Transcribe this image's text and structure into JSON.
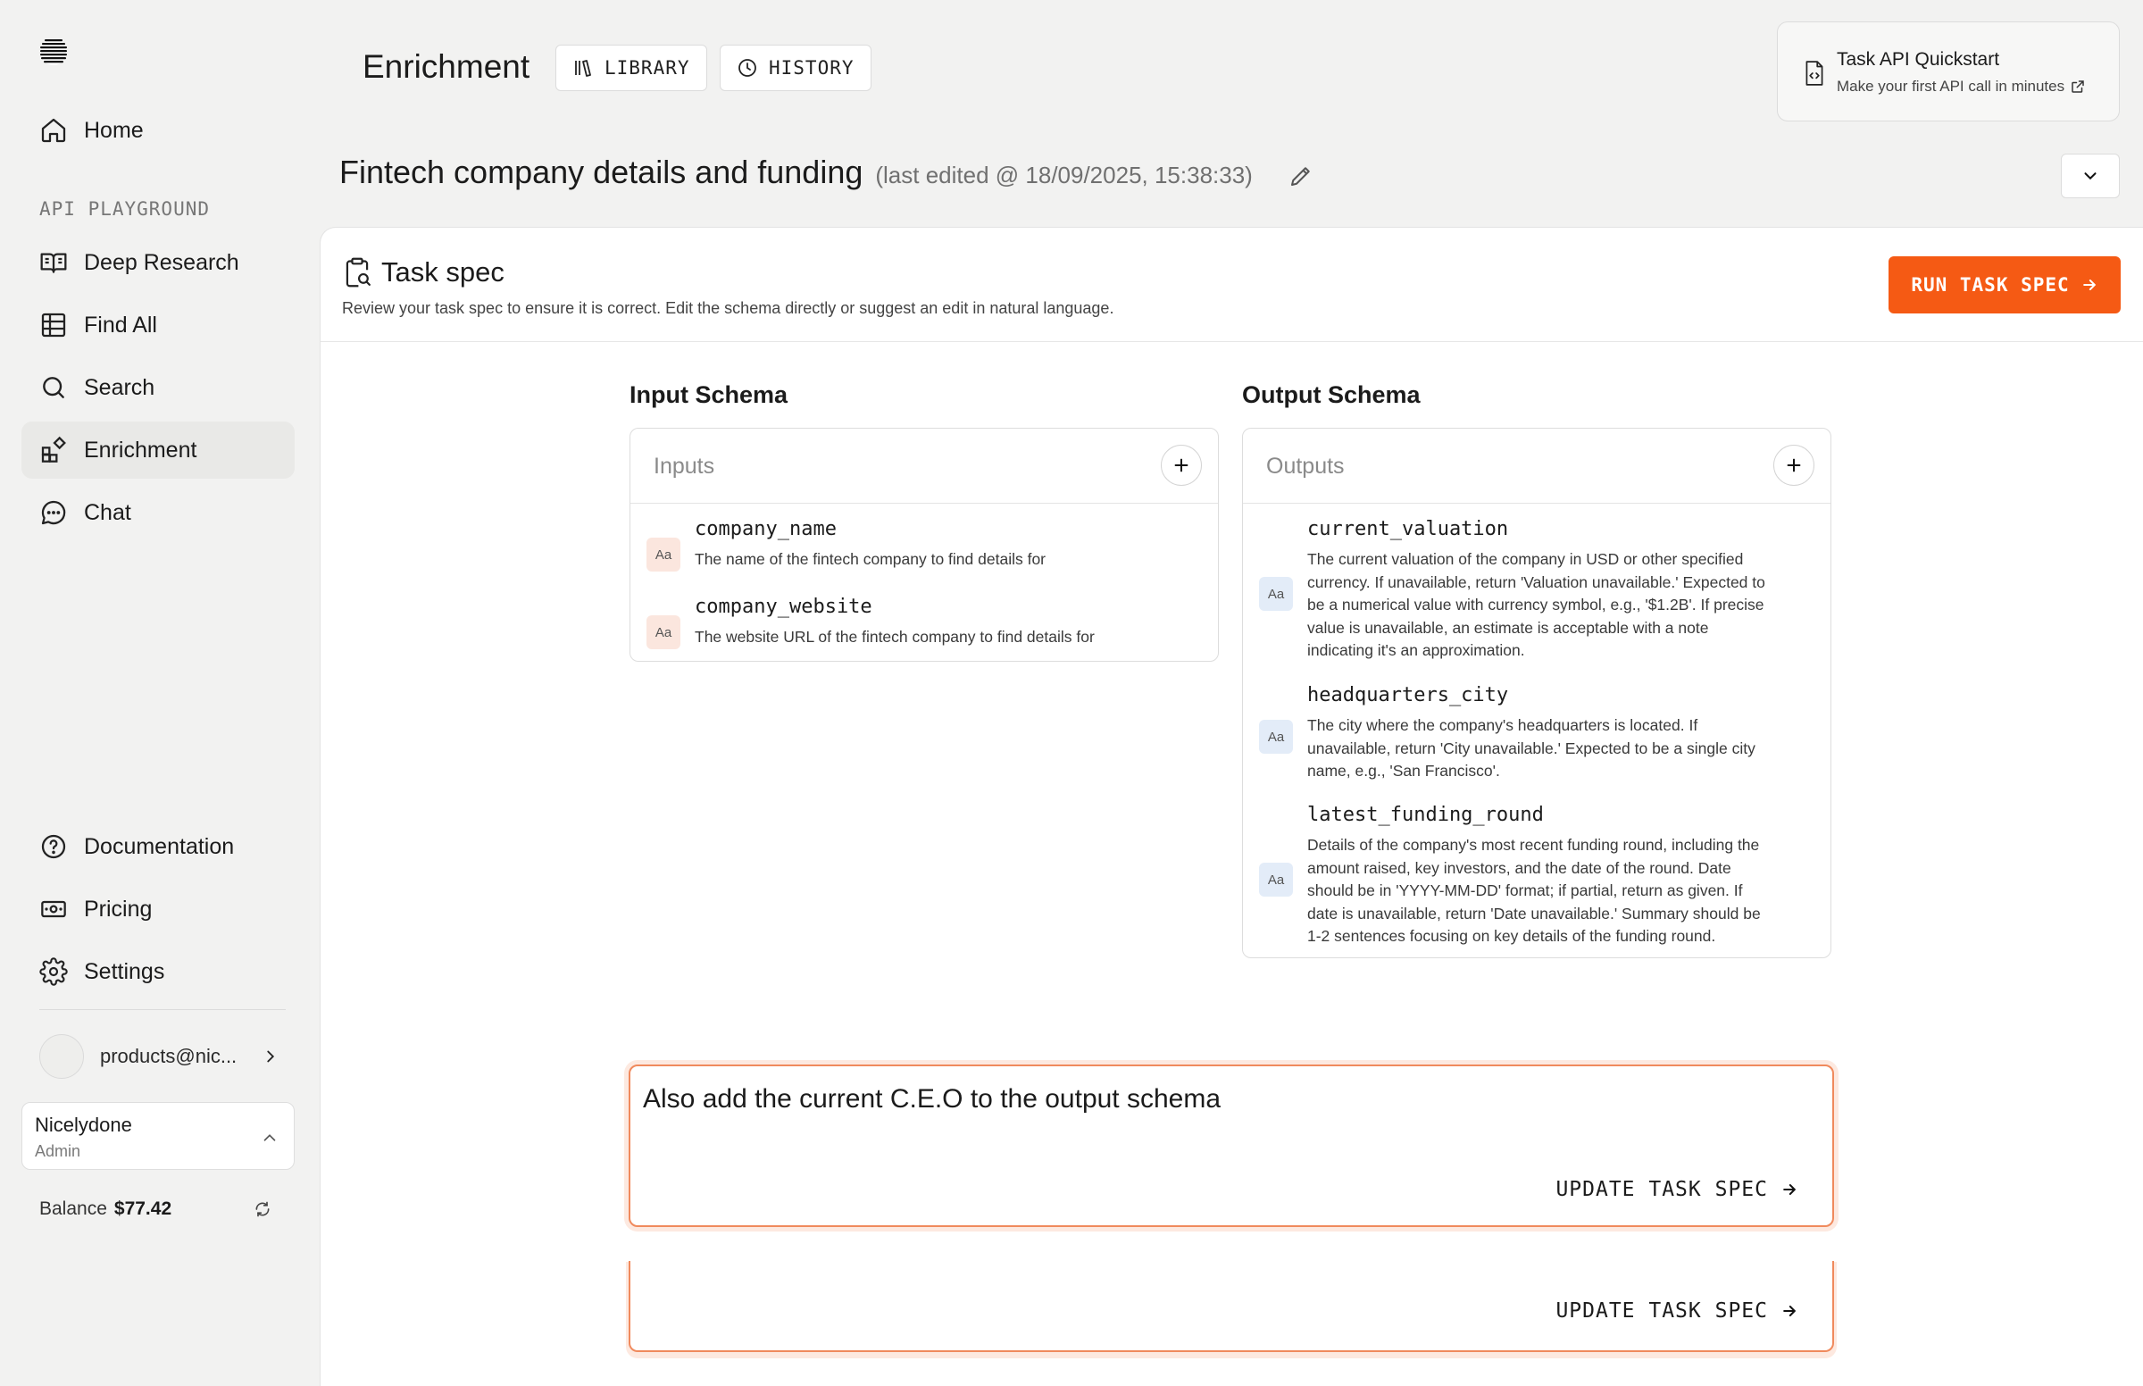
{
  "sidebar": {
    "nav_top": [
      {
        "label": "Home",
        "icon": "home-icon"
      }
    ],
    "section_label": "API PLAYGROUND",
    "nav_playground": [
      {
        "label": "Deep Research",
        "icon": "book-icon"
      },
      {
        "label": "Find All",
        "icon": "grid-icon"
      },
      {
        "label": "Search",
        "icon": "search-icon"
      },
      {
        "label": "Enrichment",
        "icon": "enrichment-icon",
        "active": true
      },
      {
        "label": "Chat",
        "icon": "chat-icon"
      }
    ],
    "nav_bottom": [
      {
        "label": "Documentation",
        "icon": "help-circle-icon"
      },
      {
        "label": "Pricing",
        "icon": "banknote-icon"
      },
      {
        "label": "Settings",
        "icon": "gear-icon"
      }
    ],
    "account_email": "products@nic...",
    "org_name": "Nicelydone",
    "org_role": "Admin",
    "balance_label": "Balance",
    "balance_value": "$77.42"
  },
  "header": {
    "title": "Enrichment",
    "library_label": "LIBRARY",
    "history_label": "HISTORY",
    "quickstart_title": "Task API Quickstart",
    "quickstart_subtitle": "Make your first API call in minutes"
  },
  "task": {
    "title": "Fintech company details and funding",
    "edited": "(last edited @ 18/09/2025, 15:38:33)"
  },
  "spec": {
    "title": "Task spec",
    "description": "Review your task spec to ensure it is correct. Edit the schema directly or suggest an edit in natural language.",
    "run_label": "RUN TASK SPEC"
  },
  "input_schema": {
    "title": "Input Schema",
    "card_label": "Inputs",
    "fields": [
      {
        "type_badge": "Aa",
        "name": "company_name",
        "description": "The name of the fintech company to find details for"
      },
      {
        "type_badge": "Aa",
        "name": "company_website",
        "description": "The website URL of the fintech company to find details for"
      }
    ]
  },
  "output_schema": {
    "title": "Output Schema",
    "card_label": "Outputs",
    "fields": [
      {
        "type_badge": "Aa",
        "name": "current_valuation",
        "description": "The current valuation of the company in USD or other specified currency. If unavailable, return 'Valuation unavailable.' Expected to be a numerical value with currency symbol, e.g., '$1.2B'. If precise value is unavailable, an estimate is acceptable with a note indicating it's an approximation."
      },
      {
        "type_badge": "Aa",
        "name": "headquarters_city",
        "description": "The city where the company's headquarters is located. If unavailable, return 'City unavailable.' Expected to be a single city name, e.g., 'San Francisco'."
      },
      {
        "type_badge": "Aa",
        "name": "latest_funding_round",
        "description": "Details of the company's most recent funding round, including the amount raised, key investors, and the date of the round. Date should be in 'YYYY-MM-DD' format; if partial, return as given. If date is unavailable, return 'Date unavailable.' Summary should be 1-2 sentences focusing on key details of the funding round."
      }
    ]
  },
  "prompt": {
    "text": "Also add the current C.E.O to the output schema",
    "update_label": "UPDATE TASK SPEC",
    "update_label_2": "UPDATE TASK SPEC"
  },
  "colors": {
    "accent": "#f55a14",
    "input_badge": "#fbe6de",
    "output_badge": "#e3ecf8"
  }
}
